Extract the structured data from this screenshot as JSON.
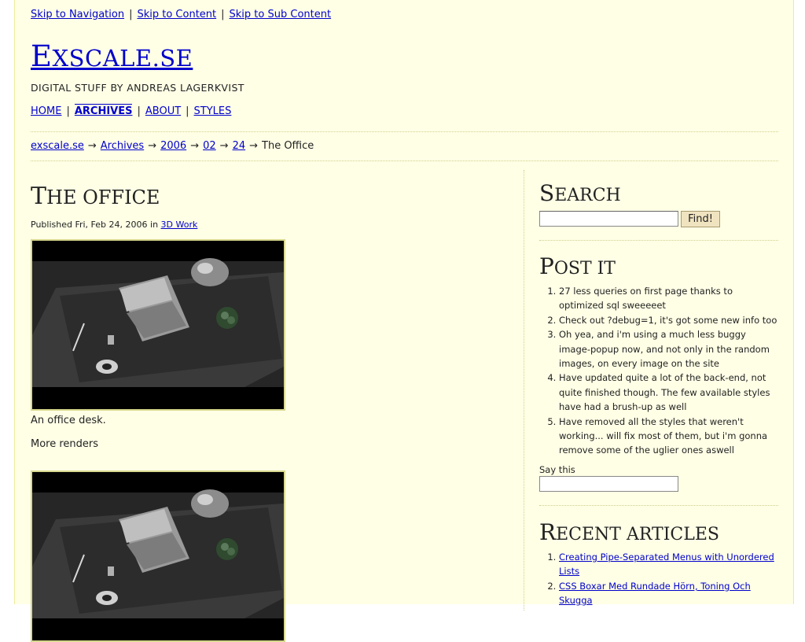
{
  "skip_links": [
    "Skip to Navigation",
    "Skip to Content",
    "Skip to Sub Content"
  ],
  "site": {
    "logo_first": "E",
    "logo_rest": "XSCALE.SE",
    "tagline": "DIGITAL STUFF BY ANDREAS LAGERKVIST"
  },
  "nav": {
    "items": [
      "HOME",
      "ARCHIVES",
      "ABOUT",
      "STYLES"
    ],
    "current": "ARCHIVES"
  },
  "breadcrumb": {
    "links": [
      "exscale.se",
      "Archives",
      "2006",
      "02",
      "24"
    ],
    "current": "The Office",
    "arrow": "→"
  },
  "post": {
    "title_first": "T",
    "title_rest": "HE OFFICE",
    "meta_prefix": "Published Fri, Feb 24, 2006 in",
    "category": "3D Work",
    "caption": "An office desk.",
    "more": "More renders"
  },
  "sidebar": {
    "search": {
      "heading_first": "S",
      "heading_rest": "EARCH",
      "input_value": "",
      "button_label": "Find!"
    },
    "post_it": {
      "heading_first": "P",
      "heading_rest": "OST IT",
      "items": [
        "27 less queries on first page thanks to optimized sql sweeeeet",
        "Check out ?debug=1, it's got some new info too",
        "Oh yea, and i'm using a much less buggy image-popup now, and not only in the random images, on every image on the site",
        "Have updated quite a lot of the back-end, not quite finished though. The few available styles have had a brush-up as well",
        "Have removed all the styles that weren't working... will fix most of them, but i'm gonna remove some of the uglier ones aswell"
      ],
      "say_label": "Say this",
      "say_value": ""
    },
    "recent": {
      "heading_first": "R",
      "heading_rest": "ECENT ARTICLES",
      "items": [
        "Creating Pipe-Separated Menus with Unordered Lists",
        "CSS Boxar Med Rundade Hörn, Toning Och Skugga"
      ]
    }
  },
  "colors": {
    "page_bg": "#ffffe6",
    "link": "#0000cc",
    "frame_border": "#d8d88e",
    "button_bg": "#f0e4c0"
  }
}
